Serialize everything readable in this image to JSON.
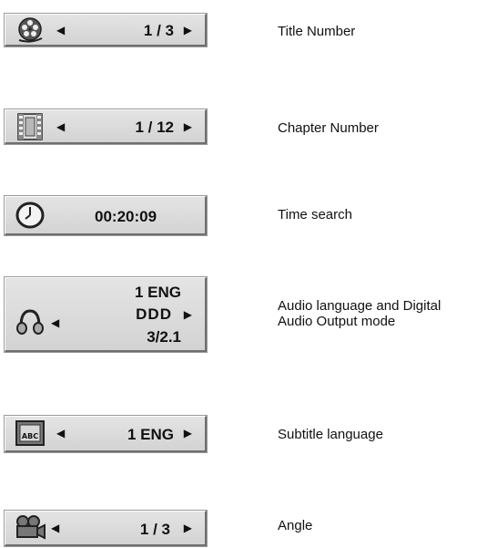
{
  "rows": [
    {
      "icon": "film-reel-icon",
      "value": "1 / 3",
      "label": "Title Number"
    },
    {
      "icon": "film-strip-icon",
      "value": "1 / 12",
      "label": "Chapter Number"
    },
    {
      "icon": "clock-icon",
      "value": "00:20:09",
      "label": "Time search"
    },
    {
      "icon": "headphones-icon",
      "value_lines": [
        "1 ENG",
        "DDD",
        "3/2.1"
      ],
      "label_lines": [
        "Audio language and Digital",
        "Audio Output mode"
      ]
    },
    {
      "icon": "abc-screen-icon",
      "value": "1 ENG",
      "label": "Subtitle language"
    },
    {
      "icon": "video-camera-icon",
      "value": "1 / 3",
      "label": "Angle"
    }
  ]
}
